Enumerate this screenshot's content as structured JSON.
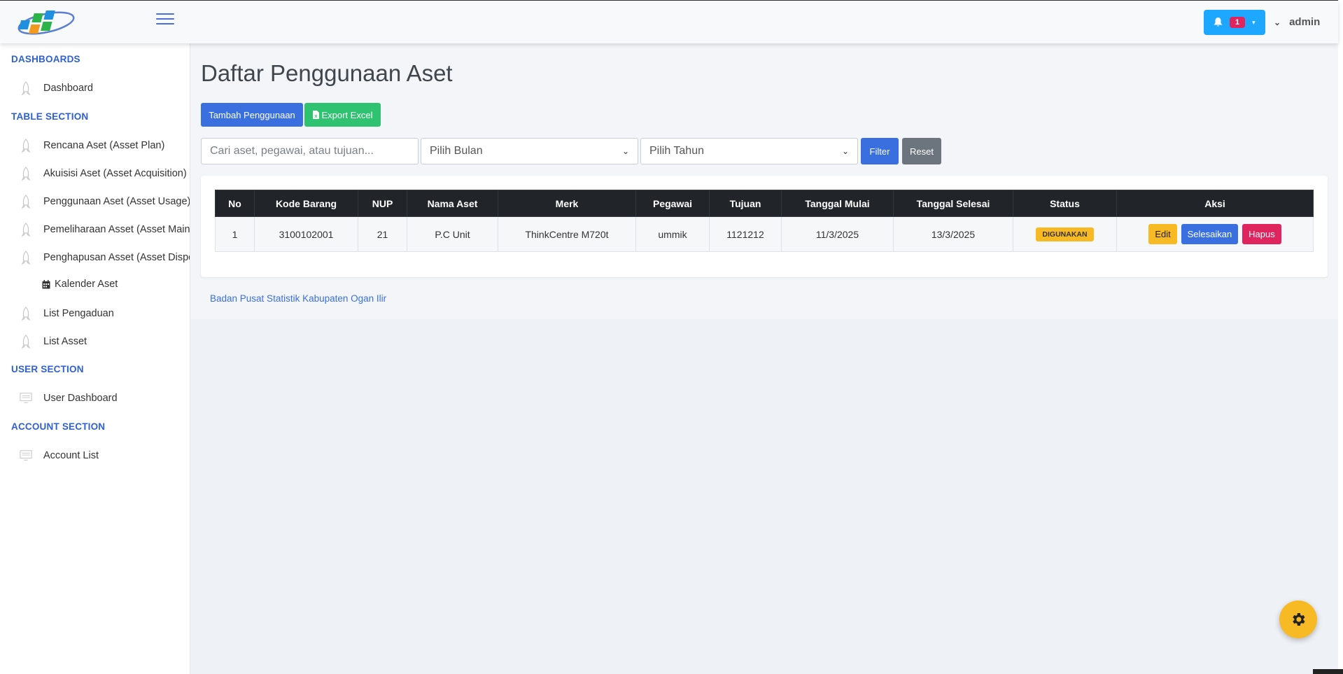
{
  "header": {
    "notification_count": "1",
    "user_name": "admin"
  },
  "sidebar": {
    "sections": [
      {
        "title": "DASHBOARDS"
      },
      {
        "title": "TABLE SECTION"
      },
      {
        "title": "USER SECTION"
      },
      {
        "title": "ACCOUNT SECTION"
      }
    ],
    "items": [
      {
        "label": "Dashboard",
        "icon": "rocket-icon"
      },
      {
        "label": "Rencana Aset (Asset Plan)",
        "icon": "rocket-icon"
      },
      {
        "label": "Akuisisi Aset (Asset Acquisition)",
        "icon": "rocket-icon"
      },
      {
        "label": "Penggunaan Aset (Asset Usage)",
        "icon": "rocket-icon"
      },
      {
        "label": "Pemeliharaan Asset (Asset Mainter",
        "icon": "rocket-icon"
      },
      {
        "label": "Penghapusan Asset (Asset Disposa",
        "icon": "rocket-icon"
      },
      {
        "label": "Kalender Aset",
        "icon": "calendar-icon"
      },
      {
        "label": "List Pengaduan",
        "icon": "rocket-icon"
      },
      {
        "label": "List Asset",
        "icon": "rocket-icon"
      },
      {
        "label": "User Dashboard",
        "icon": "monitor-icon"
      },
      {
        "label": "Account List",
        "icon": "monitor-icon"
      }
    ]
  },
  "main": {
    "title": "Daftar Penggunaan Aset",
    "add_button": "Tambah Penggunaan",
    "export_button": "Export Excel",
    "search_placeholder": "Cari aset, pegawai, atau tujuan...",
    "month_select": "Pilih Bulan",
    "year_select": "Pilih Tahun",
    "filter_button": "Filter",
    "reset_button": "Reset",
    "footer": "Badan Pusat Statistik Kabupaten Ogan Ilir"
  },
  "table": {
    "headers": [
      "No",
      "Kode Barang",
      "NUP",
      "Nama Aset",
      "Merk",
      "Pegawai",
      "Tujuan",
      "Tanggal Mulai",
      "Tanggal Selesai",
      "Status",
      "Aksi"
    ],
    "rows": [
      {
        "no": "1",
        "kode_barang": "3100102001",
        "nup": "21",
        "nama_aset": "P.C Unit",
        "merk": "ThinkCentre M720t",
        "pegawai": "ummik",
        "tujuan": "1121212",
        "tanggal_mulai": "11/3/2025",
        "tanggal_selesai": "13/3/2025",
        "status": "DIGUNAKAN",
        "actions": {
          "edit": "Edit",
          "done": "Selesaikan",
          "delete": "Hapus"
        }
      }
    ]
  },
  "colors": {
    "primary": "#3a6fdf",
    "success": "#2fc270",
    "warning": "#f7b924",
    "danger": "#e0245e",
    "secondary": "#6c757d",
    "header_dark": "#212529",
    "notif": "#1ea7ff"
  }
}
